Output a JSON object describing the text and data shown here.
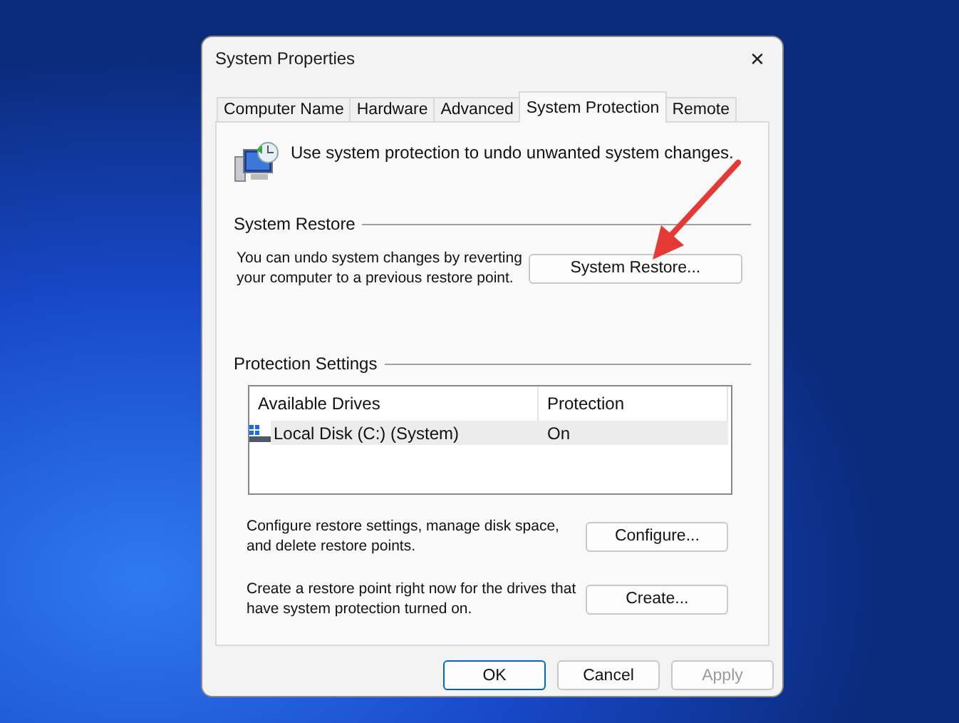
{
  "window": {
    "title": "System Properties",
    "close": "✕"
  },
  "tabs": [
    {
      "label": "Computer Name",
      "selected": false
    },
    {
      "label": "Hardware",
      "selected": false
    },
    {
      "label": "Advanced",
      "selected": false
    },
    {
      "label": "System Protection",
      "selected": true
    },
    {
      "label": "Remote",
      "selected": false
    }
  ],
  "intro": "Use system protection to undo unwanted system changes.",
  "system_restore": {
    "heading": "System Restore",
    "text": "You can undo system changes by reverting your computer to a previous restore point.",
    "button": "System Restore..."
  },
  "protection_settings": {
    "heading": "Protection Settings",
    "columns": [
      "Available Drives",
      "Protection"
    ],
    "rows": [
      {
        "drive": "Local Disk (C:) (System)",
        "protection": "On",
        "selected": true
      }
    ],
    "actions": [
      {
        "text": "Configure restore settings, manage disk space, and delete restore points.",
        "button": "Configure..."
      },
      {
        "text": "Create a restore point right now for the drives that have system protection turned on.",
        "button": "Create..."
      }
    ]
  },
  "buttons": [
    {
      "label": "OK",
      "default": true,
      "disabled": false
    },
    {
      "label": "Cancel",
      "default": false,
      "disabled": false
    },
    {
      "label": "Apply",
      "default": false,
      "disabled": true
    }
  ]
}
